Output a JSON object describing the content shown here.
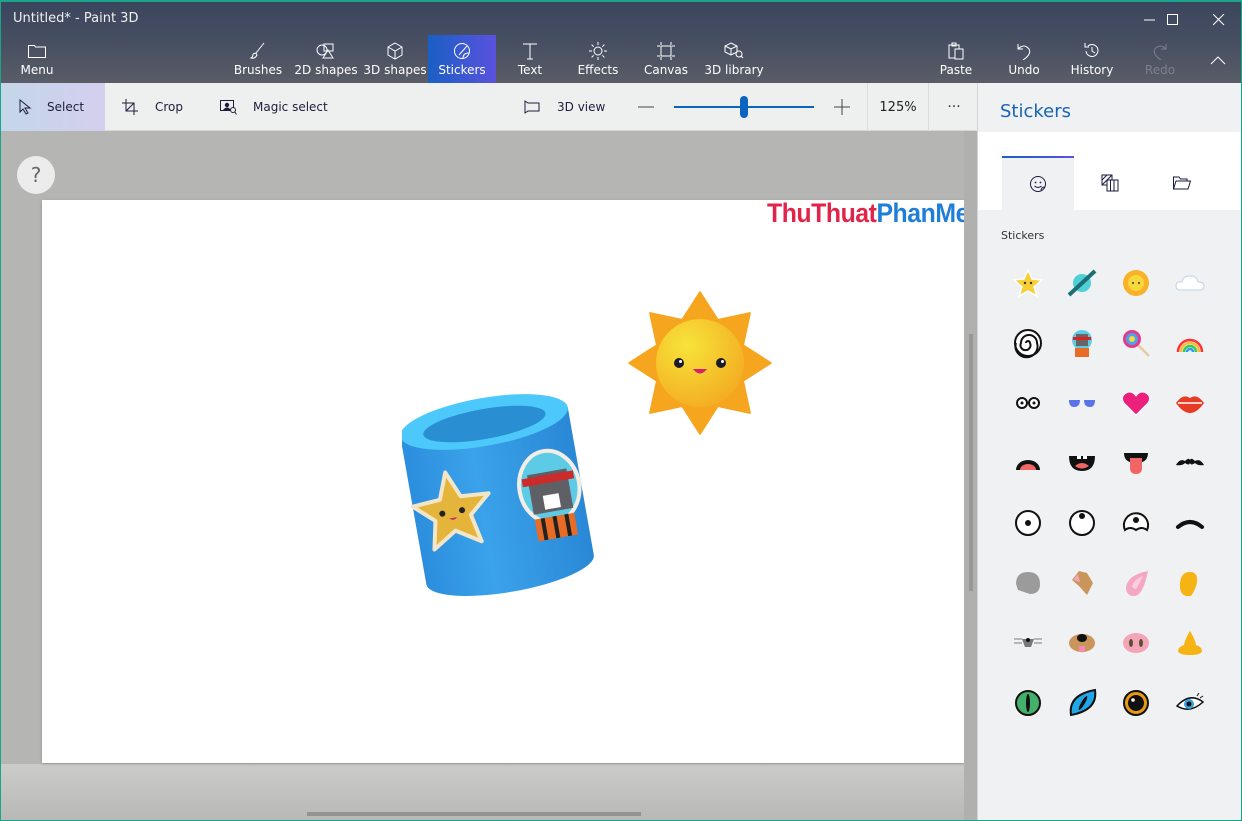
{
  "window": {
    "title": "Untitled* - Paint 3D",
    "minimize_icon": "minimize-icon",
    "maximize_icon": "maximize-icon",
    "close_icon": "close-icon"
  },
  "ribbon": {
    "menu": {
      "label": "Menu",
      "icon": "folder-icon"
    },
    "tools": [
      {
        "label": "Brushes",
        "icon": "brush-icon"
      },
      {
        "label": "2D shapes",
        "icon": "shapes-2d-icon"
      },
      {
        "label": "3D shapes",
        "icon": "cube-icon"
      },
      {
        "label": "Stickers",
        "icon": "sticker-icon",
        "active": true
      },
      {
        "label": "Text",
        "icon": "text-icon"
      },
      {
        "label": "Effects",
        "icon": "sun-effects-icon"
      },
      {
        "label": "Canvas",
        "icon": "canvas-icon"
      },
      {
        "label": "3D library",
        "icon": "library-icon"
      }
    ],
    "actions": [
      {
        "label": "Paste",
        "icon": "paste-icon"
      },
      {
        "label": "Undo",
        "icon": "undo-icon"
      },
      {
        "label": "History",
        "icon": "history-icon"
      },
      {
        "label": "Redo",
        "icon": "redo-icon",
        "disabled": true
      }
    ],
    "collapse_icon": "chevron-up-icon"
  },
  "toolbar": {
    "select": "Select",
    "crop": "Crop",
    "magic_select": "Magic select",
    "view_3d": "3D view",
    "zoom_value": "125%",
    "zoom_fraction": 0.5,
    "more": "···"
  },
  "canvas": {
    "help": "?",
    "watermark_part1": "ThuThuat",
    "watermark_part2": "PhanMem.vn"
  },
  "panel": {
    "title": "Stickers",
    "tabs": [
      {
        "name": "stickers",
        "icon": "sticker-face-icon",
        "active": true
      },
      {
        "name": "textures",
        "icon": "texture-icon"
      },
      {
        "name": "custom",
        "icon": "folder-open-icon"
      }
    ],
    "category_label": "Stickers",
    "stickers": [
      "star",
      "planet",
      "sun",
      "cloud",
      "spiral",
      "astronaut-cat",
      "lollipop",
      "rainbow",
      "glasses",
      "sunglasses",
      "heart",
      "lips",
      "open-mouth",
      "smile-mouth",
      "tongue-mouth",
      "mustache",
      "eye-center",
      "eye-up",
      "eye-worried",
      "eyebrow",
      "gray-ear",
      "dog-ear",
      "pink-ear",
      "human-ear",
      "mouse-nose",
      "dog-nose",
      "pig-nose",
      "human-nose",
      "green-cat-eye",
      "blue-cat-eye",
      "orange-eye",
      "blue-eye-lash"
    ]
  }
}
